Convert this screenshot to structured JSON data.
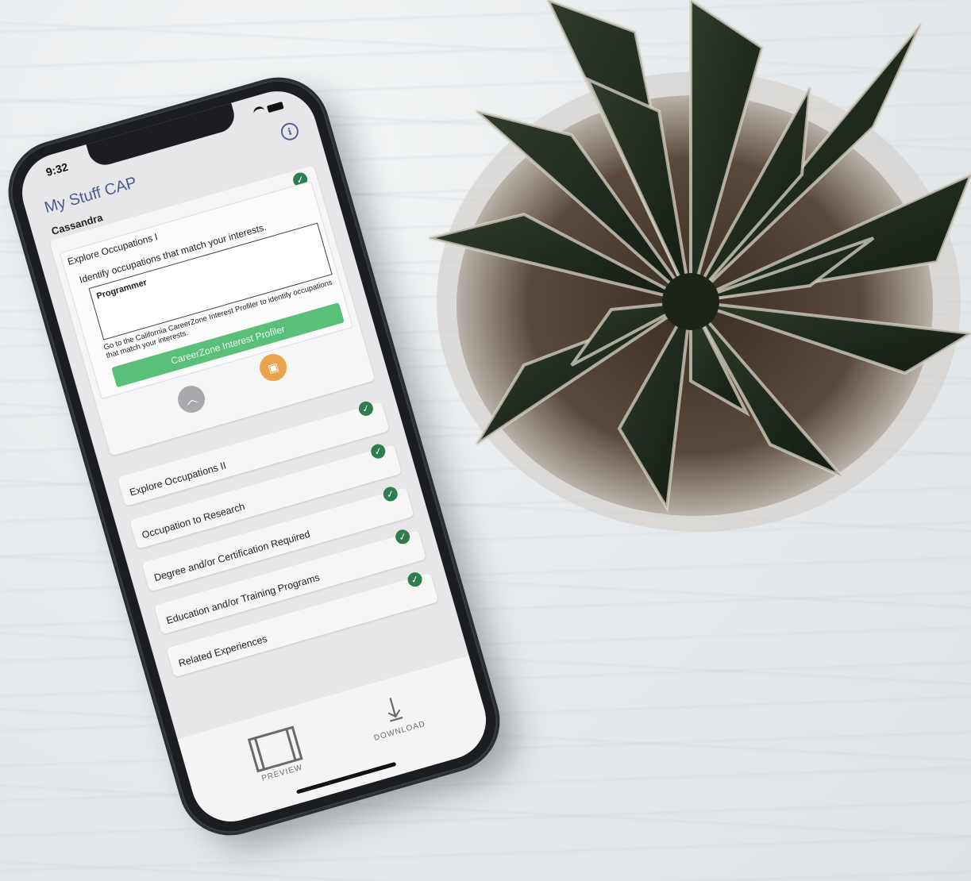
{
  "status_bar": {
    "time": "9:32"
  },
  "header": {
    "title": "My Stuff CAP",
    "user_name": "Cassandra",
    "info_icon_glyph": "i"
  },
  "expanded_step": {
    "title": "Explore Occupations I",
    "description": "Identify occupations that match your interests.",
    "answer": "Programmer",
    "help_text": "Go to the California CareerZone Interest Profiler to identify occupations that match your interests.",
    "button_label": "CareerZone Interest Profiler",
    "completed": true
  },
  "steps": [
    {
      "label": "Explore Occupations II",
      "completed": true
    },
    {
      "label": "Occupation to Research",
      "completed": true
    },
    {
      "label": "Degree and/or Certification Required",
      "completed": true
    },
    {
      "label": "Education and/or Training Programs",
      "completed": true
    },
    {
      "label": "Related Experiences",
      "completed": true
    }
  ],
  "bottom_bar": {
    "preview_label": "PREVIEW",
    "download_label": "DOWNLOAD"
  },
  "colors": {
    "accent_green": "#5bbf7c",
    "check_green": "#2f7d4e",
    "orange": "#e9a44b",
    "title_blue": "#4a5a8e"
  },
  "icons": {
    "check": "check-icon",
    "info": "info-icon",
    "collapse": "chevron-up-icon",
    "orange": "document-icon",
    "preview": "preview-icon",
    "download": "download-icon"
  }
}
